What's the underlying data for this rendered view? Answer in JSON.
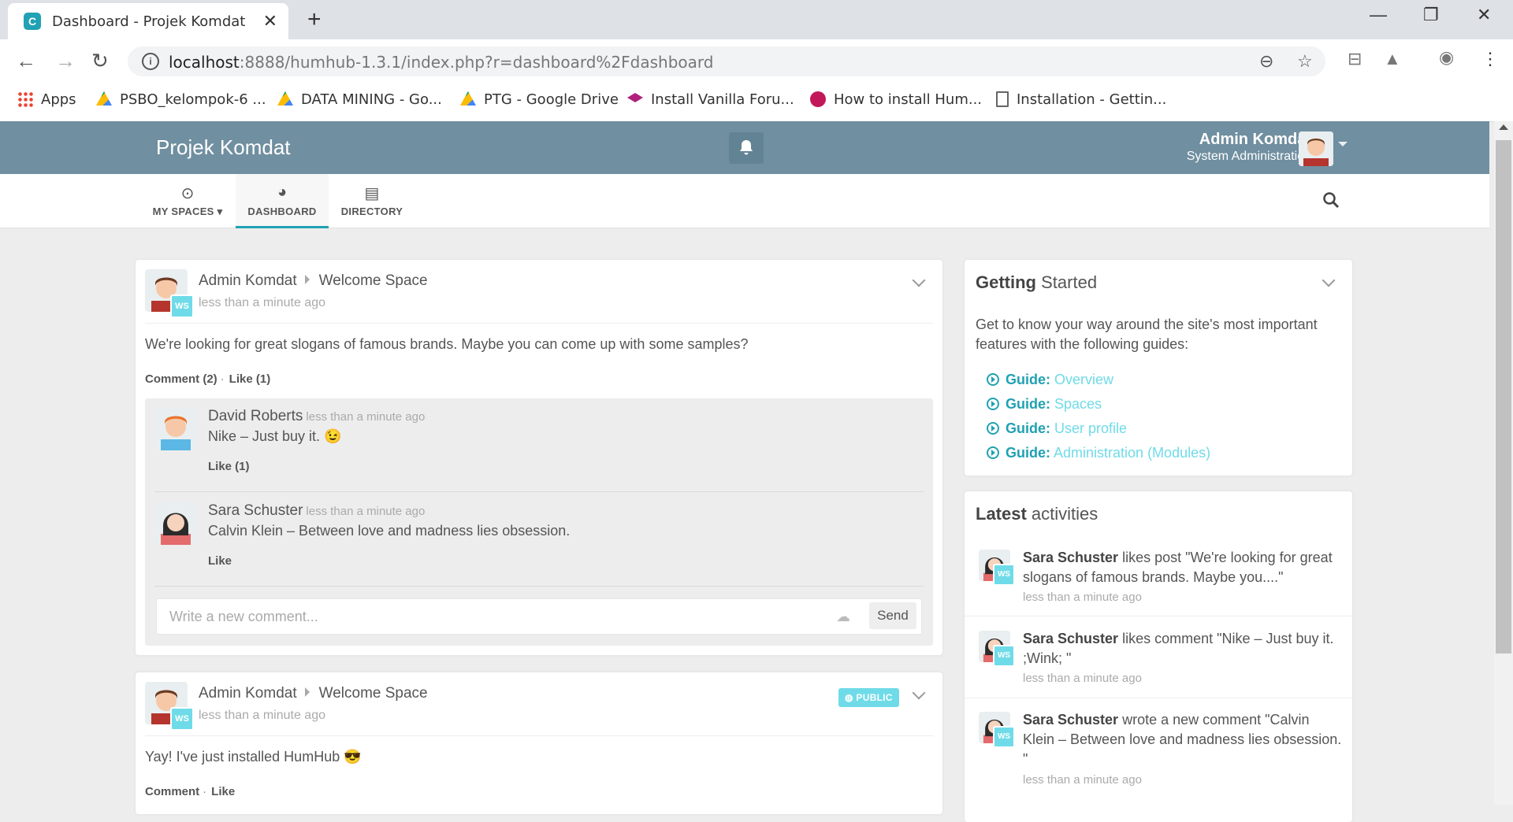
{
  "browser": {
    "tab_title": "Dashboard - Projek Komdat",
    "url_host": "localhost",
    "url_rest": ":8888/humhub-1.3.1/index.php?r=dashboard%2Fdashboard",
    "bookmarks": [
      {
        "label": "Apps"
      },
      {
        "label": "PSBO_kelompok-6 ..."
      },
      {
        "label": "DATA MINING - Go..."
      },
      {
        "label": "PTG - Google Drive"
      },
      {
        "label": "Install Vanilla Foru..."
      },
      {
        "label": "How to install Hum..."
      },
      {
        "label": "Installation - Gettin..."
      }
    ]
  },
  "app": {
    "brand": "Projek Komdat",
    "user_name": "Admin Komdat",
    "user_role": "System Administration",
    "nav": [
      {
        "label": "MY SPACES"
      },
      {
        "label": "DASHBOARD"
      },
      {
        "label": "DIRECTORY"
      }
    ]
  },
  "posts": [
    {
      "author": "Admin Komdat",
      "space": "Welcome Space",
      "badge": "WS",
      "time": "less than a minute ago",
      "text": "We're looking for great slogans of famous brands. Maybe you can come up with some samples?",
      "comment_label": "Comment (2)",
      "like_label": "Like (1)",
      "comments": [
        {
          "name": "David Roberts",
          "time": "less than a minute ago",
          "text": "Nike – Just buy it. 😉",
          "like": "Like (1)"
        },
        {
          "name": "Sara Schuster",
          "time": "less than a minute ago",
          "text": "Calvin Klein – Between love and madness lies obsession.",
          "like": "Like"
        }
      ],
      "comment_placeholder": "Write a new comment...",
      "send_label": "Send"
    },
    {
      "author": "Admin Komdat",
      "space": "Welcome Space",
      "badge": "WS",
      "visibility": "PUBLIC",
      "time": "less than a minute ago",
      "text": "Yay! I've just installed HumHub 😎",
      "comment_label": "Comment",
      "like_label": "Like"
    }
  ],
  "getting_started": {
    "title_bold": "Getting",
    "title_rest": "Started",
    "intro": "Get to know your way around the site's most important features with the following guides:",
    "guides": [
      {
        "prefix": "Guide:",
        "label": "Overview"
      },
      {
        "prefix": "Guide:",
        "label": "Spaces"
      },
      {
        "prefix": "Guide:",
        "label": "User profile"
      },
      {
        "prefix": "Guide:",
        "label": "Administration (Modules)"
      }
    ]
  },
  "activities": {
    "title_bold": "Latest",
    "title_rest": "activities",
    "items": [
      {
        "user": "Sara Schuster",
        "text": "likes post \"We're looking for great slogans of famous brands. Maybe you....\"",
        "time": "less than a minute ago",
        "badge": "WS"
      },
      {
        "user": "Sara Schuster",
        "text": "likes comment \"Nike – Just buy it. ;Wink; \"",
        "time": "less than a minute ago",
        "badge": "WS"
      },
      {
        "user": "Sara Schuster",
        "text": "wrote a new comment \"Calvin Klein – Between love and madness lies obsession. \"",
        "time": "less than a minute ago",
        "badge": "WS"
      }
    ]
  }
}
